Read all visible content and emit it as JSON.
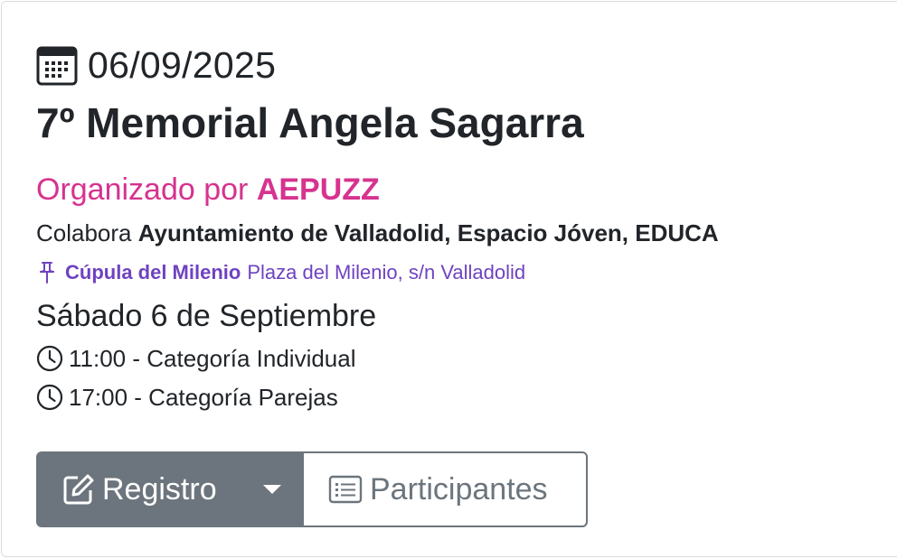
{
  "event": {
    "date": "06/09/2025",
    "title": "7º Memorial Angela Sagarra",
    "organizer_prefix": "Organizado por",
    "organizer_name": "AEPUZZ",
    "collab_prefix": "Colabora",
    "collaborators": "Ayuntamiento de Valladolid, Espacio Jóven, EDUCA",
    "venue": "Cúpula del Milenio",
    "address": "Plaza del Milenio, s/n Valladolid",
    "day": "Sábado 6 de Septiembre",
    "schedule": [
      {
        "text": "11:00 - Categoría Individual"
      },
      {
        "text": "17:00 - Categoría Parejas"
      }
    ]
  },
  "actions": {
    "register_label": "Registro",
    "participants_label": "Participantes"
  },
  "icons": {
    "date": "calendar-icon",
    "location": "pin-icon",
    "time": "clock-icon",
    "register": "edit-icon",
    "dropdown": "caret-down-icon",
    "participants": "list-icon"
  },
  "colors": {
    "organizer": "#d6338f",
    "location": "#6f42c1",
    "button_secondary": "#6c757d"
  }
}
